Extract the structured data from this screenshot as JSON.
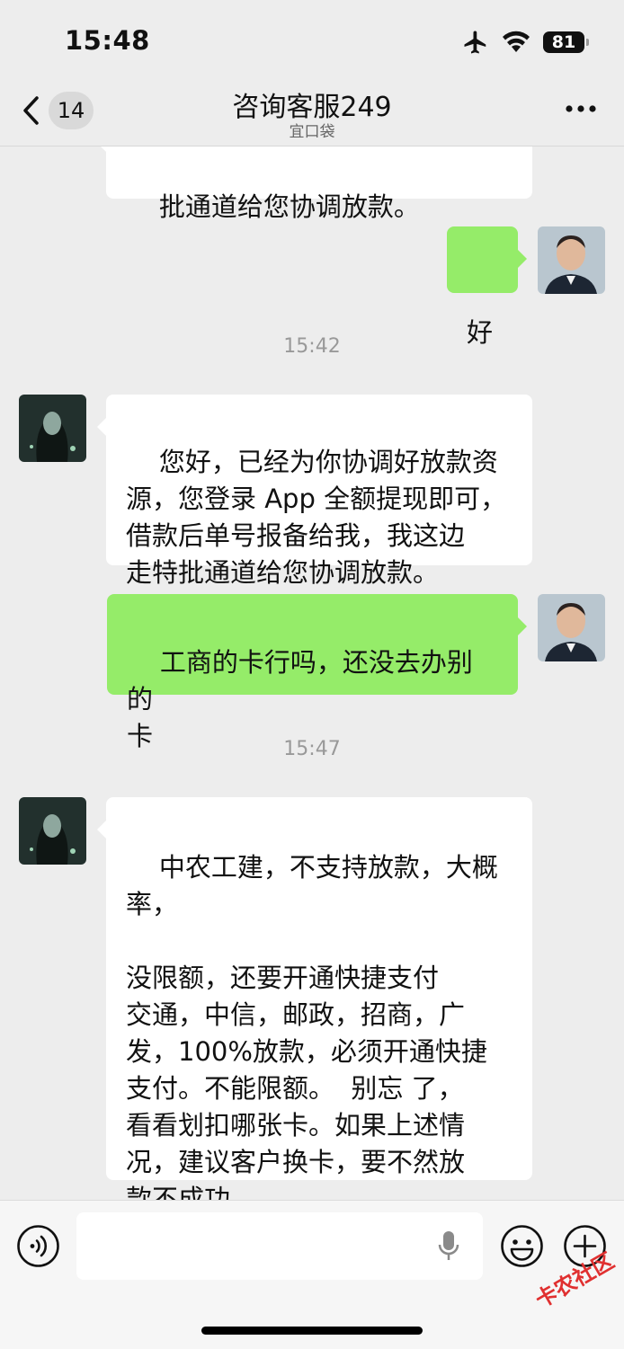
{
  "status": {
    "time": "15:48",
    "battery": "81"
  },
  "nav": {
    "unread": "14",
    "title": "咨询客服249",
    "subtitle": "宜口袋"
  },
  "messages": [
    {
      "text": "批通道给您协调放款。"
    },
    {
      "text": "好"
    },
    {
      "timestamp": "15:42"
    },
    {
      "text": "您好，已经为你协调好放款资\n源，您登录 App 全额提现即可，\n借款后单号报备给我，我这边\n走特批通道给您协调放款。"
    },
    {
      "text": "工商的卡行吗，还没去办别的\n卡"
    },
    {
      "timestamp": "15:47"
    },
    {
      "text": "中农工建，不支持放款，大概\n率，\n\n没限额，还要开通快捷支付\n交通，中信，邮政，招商，广\n发，100%放款，必须开通快捷\n支付。不能限额。  别忘 了，\n看看划扣哪张卡。如果上述情\n况，建议客户换卡，要不然放\n款不成功"
    }
  ],
  "watermark": "卡农社区",
  "colors": {
    "outgoing_bubble": "#95ec69",
    "incoming_bubble": "#ffffff",
    "background": "#ededed"
  }
}
